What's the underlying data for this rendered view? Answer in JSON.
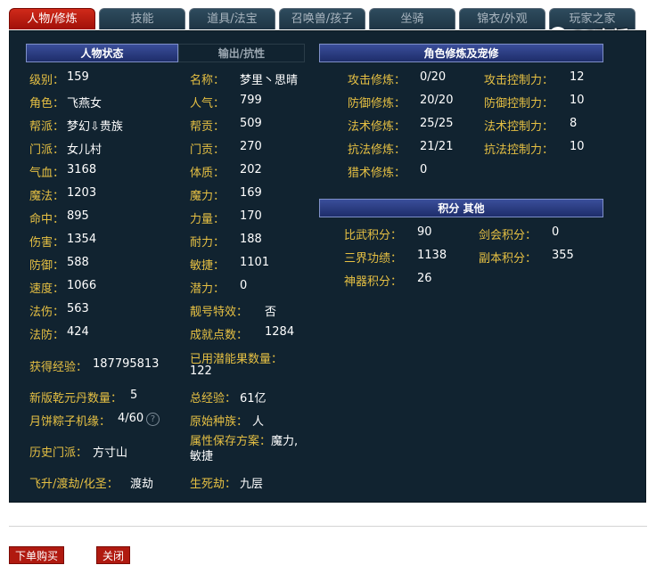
{
  "tabs": [
    "人物/修炼",
    "技能",
    "道具/法宝",
    "召唤兽/孩子",
    "坐骑",
    "锦衣/外观",
    "玩家之家"
  ],
  "logo_text": "CC直播",
  "left": {
    "header_active": "人物状态",
    "header_inactive": "输出/抗性",
    "col1": [
      {
        "label": "级别：",
        "value": "159"
      },
      {
        "label": "角色：",
        "value": "飞燕女"
      },
      {
        "label": "帮派：",
        "value": "梦幻⇩贵族"
      },
      {
        "label": "门派：",
        "value": "女儿村"
      },
      {
        "label": "气血：",
        "value": "3168"
      },
      {
        "label": "魔法：",
        "value": "1203"
      },
      {
        "label": "命中：",
        "value": "895"
      },
      {
        "label": "伤害：",
        "value": "1354"
      },
      {
        "label": "防御：",
        "value": "588"
      },
      {
        "label": "速度：",
        "value": "1066"
      },
      {
        "label": "法伤：",
        "value": "563"
      },
      {
        "label": "法防：",
        "value": "424"
      }
    ],
    "col2": [
      {
        "label": "名称：",
        "value": "梦里丶思晴"
      },
      {
        "label": "人气：",
        "value": "799"
      },
      {
        "label": "帮贡：",
        "value": "509"
      },
      {
        "label": "门贡：",
        "value": "270"
      },
      {
        "label": "体质：",
        "value": "202"
      },
      {
        "label": "魔力：",
        "value": "169"
      },
      {
        "label": "力量：",
        "value": "170"
      },
      {
        "label": "耐力：",
        "value": "188"
      },
      {
        "label": "敏捷：",
        "value": "1101"
      },
      {
        "label": "潜力：",
        "value": "0"
      },
      {
        "label": "靓号特效：",
        "value": "否"
      },
      {
        "label": "成就点数：",
        "value": "1284"
      }
    ],
    "exp": {
      "label": "获得经验：",
      "value": "187795813"
    },
    "potion": {
      "label": "已用潜能果数量：",
      "value": "122"
    },
    "qianyuan": {
      "label": "新版乾元丹数量：",
      "value": "5"
    },
    "total_exp": {
      "label": "总经验：",
      "value": "61亿"
    },
    "zongzi": {
      "label": "月饼粽子机缘：",
      "value": "4/60"
    },
    "race": {
      "label": "原始种族：",
      "value": "人"
    },
    "history": {
      "label": "历史门派：",
      "value": "方寸山"
    },
    "attr_scheme": {
      "label": "属性保存方案：",
      "value": "魔力,敏捷"
    },
    "ascend": {
      "label": "飞升/渡劫/化圣：",
      "value": "渡劫"
    },
    "life_tribulation": {
      "label": "生死劫：",
      "value": "九层"
    }
  },
  "right": {
    "header": "角色修炼及宠修",
    "cultivation": [
      {
        "label": "攻击修炼：",
        "value": "0/20"
      },
      {
        "label": "防御修炼：",
        "value": "20/20"
      },
      {
        "label": "法术修炼：",
        "value": "25/25"
      },
      {
        "label": "抗法修炼：",
        "value": "21/21"
      },
      {
        "label": "猎术修炼：",
        "value": "0"
      }
    ],
    "control": [
      {
        "label": "攻击控制力：",
        "value": "12"
      },
      {
        "label": "防御控制力：",
        "value": "10"
      },
      {
        "label": "法术控制力：",
        "value": "8"
      },
      {
        "label": "抗法控制力：",
        "value": "10"
      }
    ],
    "header2": "积分  其他",
    "points_col1": [
      {
        "label": "比武积分：",
        "value": "90"
      },
      {
        "label": "三界功绩：",
        "value": "1138"
      },
      {
        "label": "神器积分：",
        "value": "26"
      }
    ],
    "points_col2": [
      {
        "label": "剑会积分：",
        "value": "0"
      },
      {
        "label": "副本积分：",
        "value": "355"
      }
    ]
  },
  "buttons": {
    "order": "下单购买",
    "close": "关闭"
  }
}
